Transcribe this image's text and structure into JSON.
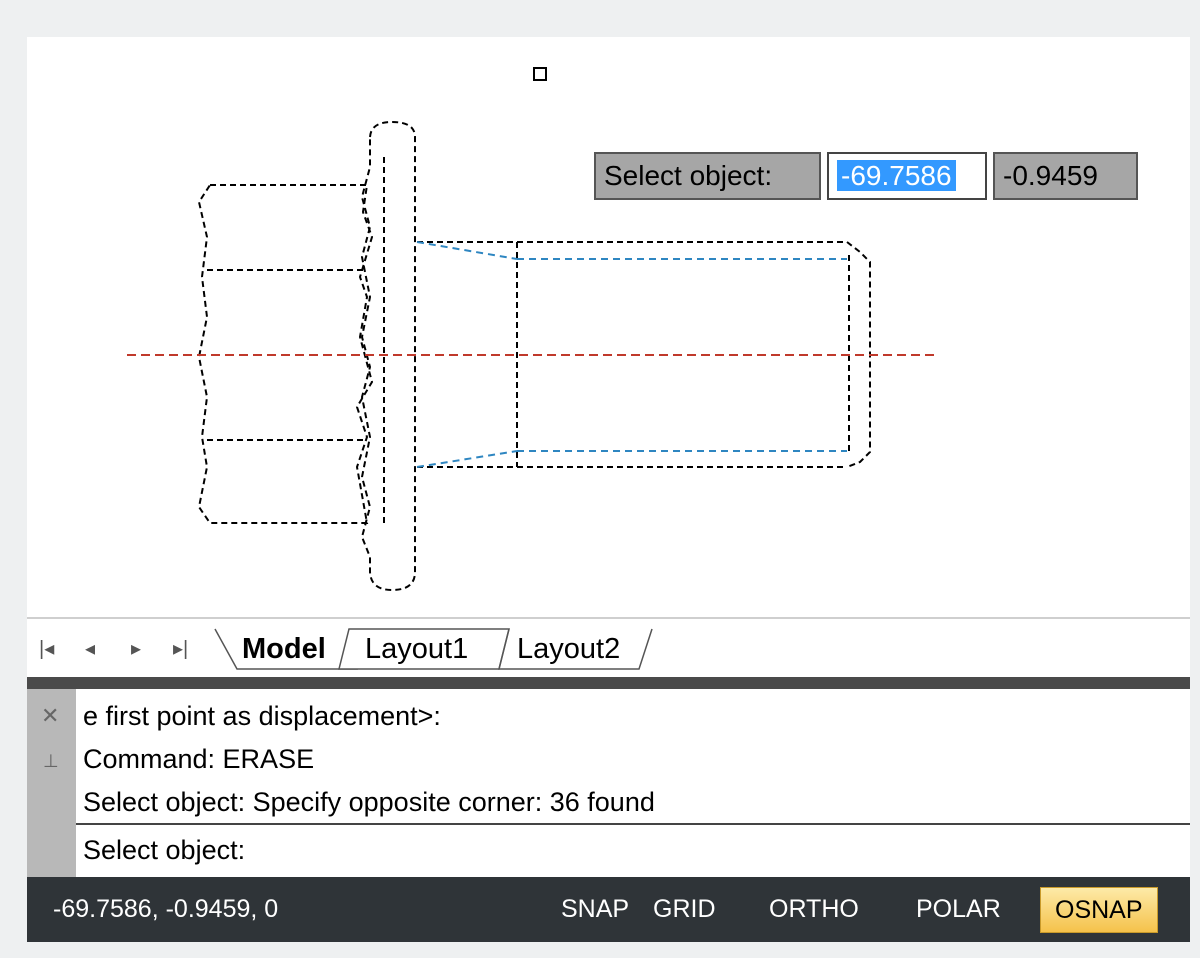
{
  "dynamic_input": {
    "prompt": "Select object:",
    "x_value": "-69.7586",
    "y_value": "-0.9459"
  },
  "drawing": {
    "icons": [
      "pickbox-cursor",
      "bolt-drawing"
    ]
  },
  "layout_tabs": {
    "nav": [
      "first-tab-icon",
      "prev-tab-icon",
      "next-tab-icon",
      "last-tab-icon"
    ],
    "tabs": [
      "Model",
      "Layout1",
      "Layout2"
    ],
    "active": "Model"
  },
  "command_window": {
    "history": [
      "e first point as displacement>:",
      "Command: ERASE",
      "Select object: Specify opposite corner: 36 found"
    ],
    "input": "Select object:",
    "icons": [
      "close-icon",
      "pin-icon"
    ]
  },
  "status_bar": {
    "coordinates": "-69.7586, -0.9459, 0",
    "toggles": [
      "SNAP",
      "GRID",
      "ORTHO",
      "POLAR",
      "OSNAP"
    ],
    "active_toggle": "OSNAP"
  },
  "colors": {
    "centerline": "#c0392b",
    "thread_lines": "#2e86c1",
    "selected_outline": "#000000",
    "status_bar_bg": "#2f3438",
    "active_toggle": "#f5c24b"
  }
}
